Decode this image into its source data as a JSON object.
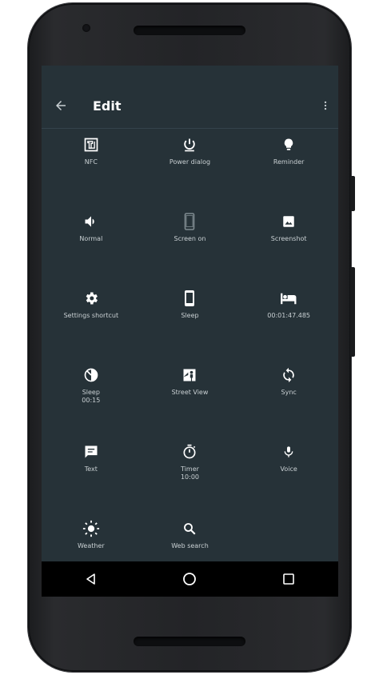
{
  "appbar": {
    "title": "Edit"
  },
  "tiles": [
    {
      "label": "NFC",
      "sub": "",
      "icon": "nfc-icon"
    },
    {
      "label": "Power dialog",
      "sub": "",
      "icon": "power-icon"
    },
    {
      "label": "Reminder",
      "sub": "",
      "icon": "lightbulb-icon"
    },
    {
      "label": "Normal",
      "sub": "",
      "icon": "volume-icon"
    },
    {
      "label": "Screen on",
      "sub": "",
      "icon": "phone-outline-icon"
    },
    {
      "label": "Screenshot",
      "sub": "",
      "icon": "image-icon"
    },
    {
      "label": "Settings shortcut",
      "sub": "",
      "icon": "gear-icon"
    },
    {
      "label": "Sleep",
      "sub": "",
      "icon": "phone-icon"
    },
    {
      "label": "00:01:47.485",
      "sub": "",
      "icon": "bed-icon"
    },
    {
      "label": "Sleep",
      "sub": "00:15",
      "icon": "timer-pie-icon"
    },
    {
      "label": "Street View",
      "sub": "",
      "icon": "street-view-icon"
    },
    {
      "label": "Sync",
      "sub": "",
      "icon": "sync-icon"
    },
    {
      "label": "Text",
      "sub": "",
      "icon": "message-icon"
    },
    {
      "label": "Timer",
      "sub": "10:00",
      "icon": "stopwatch-icon"
    },
    {
      "label": "Voice",
      "sub": "",
      "icon": "mic-icon"
    },
    {
      "label": "Weather",
      "sub": "",
      "icon": "sun-icon"
    },
    {
      "label": "Web search",
      "sub": "",
      "icon": "search-icon"
    }
  ],
  "colors": {
    "screen_bg": "#263238",
    "icon": "#ffffff",
    "label": "#c9d0d3"
  }
}
